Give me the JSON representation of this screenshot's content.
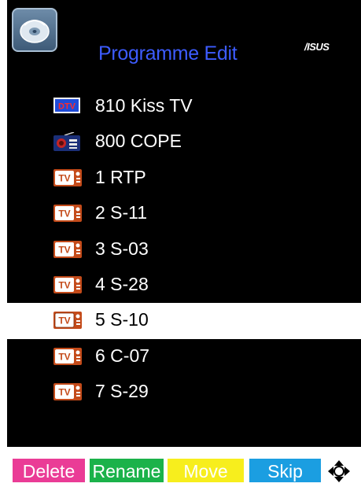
{
  "header": {
    "title": "Programme Edit",
    "brand": "/ISUS"
  },
  "channels": [
    {
      "label": "810 Kiss TV",
      "icon": "dtv-icon",
      "selected": false
    },
    {
      "label": "800 COPE",
      "icon": "radio-icon",
      "selected": false
    },
    {
      "label": "1 RTP",
      "icon": "tv-icon",
      "selected": false
    },
    {
      "label": "2 S-11",
      "icon": "tv-icon",
      "selected": false
    },
    {
      "label": "3 S-03",
      "icon": "tv-icon",
      "selected": false
    },
    {
      "label": "4 S-28",
      "icon": "tv-icon",
      "selected": false
    },
    {
      "label": "5 S-10",
      "icon": "tv-icon",
      "selected": true
    },
    {
      "label": "6 C-07",
      "icon": "tv-icon",
      "selected": false
    },
    {
      "label": "7 S-29",
      "icon": "tv-icon",
      "selected": false
    }
  ],
  "icon_text": {
    "dtv": "DTV",
    "tv": "TV"
  },
  "buttons": {
    "delete": "Delete",
    "rename": "Rename",
    "move": "Move",
    "skip": "Skip"
  },
  "colors": {
    "title": "#3d5cff",
    "delete": "#ea3c96",
    "rename": "#1bb24a",
    "move": "#f7ee1d",
    "skip": "#1b9ee1"
  }
}
